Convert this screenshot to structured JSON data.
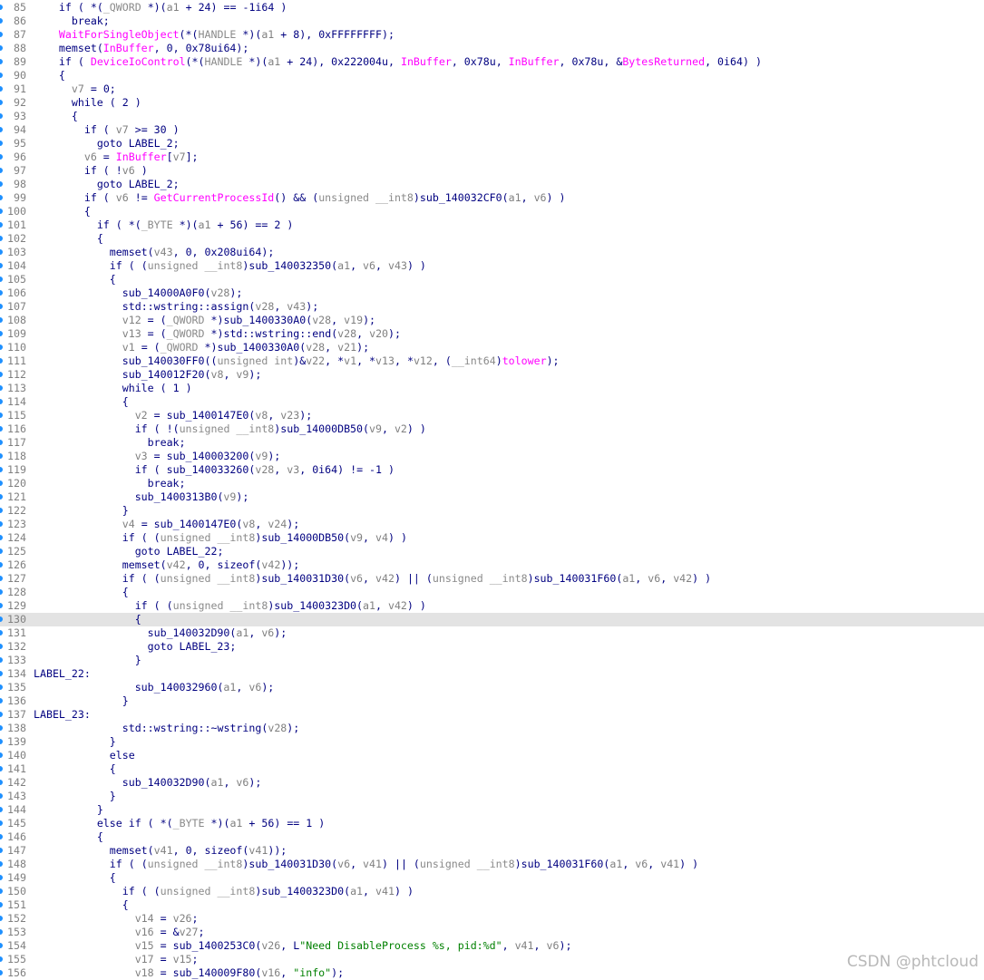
{
  "watermark": "CSDN @phtcloud",
  "highlighted_line": 130,
  "colors": {
    "text": "#000080",
    "variable": "#808080",
    "type": "#8a8a8a",
    "import_function": "#ff00ff",
    "line_number": "#808080",
    "string": "#008000",
    "marker_dot": "#1e90ff",
    "current_line_bg": "#e3e3e3"
  },
  "lines": [
    {
      "n": "85",
      "c": "    if ( *(_QWORD *)(a1 + 24) == -1i64 )"
    },
    {
      "n": "86",
      "c": "      break;"
    },
    {
      "n": "87",
      "c": "    WaitForSingleObject(*(HANDLE *)(a1 + 8), 0xFFFFFFFF);"
    },
    {
      "n": "88",
      "c": "    memset(InBuffer, 0, 0x78ui64);"
    },
    {
      "n": "89",
      "c": "    if ( DeviceIoControl(*(HANDLE *)(a1 + 24), 0x222004u, InBuffer, 0x78u, InBuffer, 0x78u, &BytesReturned, 0i64) )"
    },
    {
      "n": "90",
      "c": "    {"
    },
    {
      "n": "91",
      "c": "      v7 = 0;"
    },
    {
      "n": "92",
      "c": "      while ( 2 )"
    },
    {
      "n": "93",
      "c": "      {"
    },
    {
      "n": "94",
      "c": "        if ( v7 >= 30 )"
    },
    {
      "n": "95",
      "c": "          goto LABEL_2;"
    },
    {
      "n": "96",
      "c": "        v6 = InBuffer[v7];"
    },
    {
      "n": "97",
      "c": "        if ( !v6 )"
    },
    {
      "n": "98",
      "c": "          goto LABEL_2;"
    },
    {
      "n": "99",
      "c": "        if ( v6 != GetCurrentProcessId() && (unsigned __int8)sub_140032CF0(a1, v6) )"
    },
    {
      "n": "100",
      "c": "        {"
    },
    {
      "n": "101",
      "c": "          if ( *(_BYTE *)(a1 + 56) == 2 )"
    },
    {
      "n": "102",
      "c": "          {"
    },
    {
      "n": "103",
      "c": "            memset(v43, 0, 0x208ui64);"
    },
    {
      "n": "104",
      "c": "            if ( (unsigned __int8)sub_140032350(a1, v6, v43) )"
    },
    {
      "n": "105",
      "c": "            {"
    },
    {
      "n": "106",
      "c": "              sub_14000A0F0(v28);"
    },
    {
      "n": "107",
      "c": "              std::wstring::assign(v28, v43);"
    },
    {
      "n": "108",
      "c": "              v12 = (_QWORD *)sub_1400330A0(v28, v19);"
    },
    {
      "n": "109",
      "c": "              v13 = (_QWORD *)std::wstring::end(v28, v20);"
    },
    {
      "n": "110",
      "c": "              v1 = (_QWORD *)sub_1400330A0(v28, v21);"
    },
    {
      "n": "111",
      "c": "              sub_140030FF0((unsigned int)&v22, *v1, *v13, *v12, (__int64)tolower);"
    },
    {
      "n": "112",
      "c": "              sub_140012F20(v8, v9);"
    },
    {
      "n": "113",
      "c": "              while ( 1 )"
    },
    {
      "n": "114",
      "c": "              {"
    },
    {
      "n": "115",
      "c": "                v2 = sub_1400147E0(v8, v23);"
    },
    {
      "n": "116",
      "c": "                if ( !(unsigned __int8)sub_14000DB50(v9, v2) )"
    },
    {
      "n": "117",
      "c": "                  break;"
    },
    {
      "n": "118",
      "c": "                v3 = sub_140003200(v9);"
    },
    {
      "n": "119",
      "c": "                if ( sub_140033260(v28, v3, 0i64) != -1 )"
    },
    {
      "n": "120",
      "c": "                  break;"
    },
    {
      "n": "121",
      "c": "                sub_1400313B0(v9);"
    },
    {
      "n": "122",
      "c": "              }"
    },
    {
      "n": "123",
      "c": "              v4 = sub_1400147E0(v8, v24);"
    },
    {
      "n": "124",
      "c": "              if ( (unsigned __int8)sub_14000DB50(v9, v4) )"
    },
    {
      "n": "125",
      "c": "                goto LABEL_22;"
    },
    {
      "n": "126",
      "c": "              memset(v42, 0, sizeof(v42));"
    },
    {
      "n": "127",
      "c": "              if ( (unsigned __int8)sub_140031D30(v6, v42) || (unsigned __int8)sub_140031F60(a1, v6, v42) )"
    },
    {
      "n": "128",
      "c": "              {"
    },
    {
      "n": "129",
      "c": "                if ( (unsigned __int8)sub_1400323D0(a1, v42) )"
    },
    {
      "n": "130",
      "c": "                {"
    },
    {
      "n": "131",
      "c": "                  sub_140032D90(a1, v6);"
    },
    {
      "n": "132",
      "c": "                  goto LABEL_23;"
    },
    {
      "n": "133",
      "c": "                }"
    },
    {
      "n": "134",
      "c": "LABEL_22:"
    },
    {
      "n": "135",
      "c": "                sub_140032960(a1, v6);"
    },
    {
      "n": "136",
      "c": "              }"
    },
    {
      "n": "137",
      "c": "LABEL_23:"
    },
    {
      "n": "138",
      "c": "              std::wstring::~wstring(v28);"
    },
    {
      "n": "139",
      "c": "            }"
    },
    {
      "n": "140",
      "c": "            else"
    },
    {
      "n": "141",
      "c": "            {"
    },
    {
      "n": "142",
      "c": "              sub_140032D90(a1, v6);"
    },
    {
      "n": "143",
      "c": "            }"
    },
    {
      "n": "144",
      "c": "          }"
    },
    {
      "n": "145",
      "c": "          else if ( *(_BYTE *)(a1 + 56) == 1 )"
    },
    {
      "n": "146",
      "c": "          {"
    },
    {
      "n": "147",
      "c": "            memset(v41, 0, sizeof(v41));"
    },
    {
      "n": "148",
      "c": "            if ( (unsigned __int8)sub_140031D30(v6, v41) || (unsigned __int8)sub_140031F60(a1, v6, v41) )"
    },
    {
      "n": "149",
      "c": "            {"
    },
    {
      "n": "150",
      "c": "              if ( (unsigned __int8)sub_1400323D0(a1, v41) )"
    },
    {
      "n": "151",
      "c": "              {"
    },
    {
      "n": "152",
      "c": "                v14 = v26;"
    },
    {
      "n": "153",
      "c": "                v16 = &v27;"
    },
    {
      "n": "154",
      "c": "                v15 = sub_1400253C0(v26, L\"Need DisableProcess %s, pid:%d\", v41, v6);"
    },
    {
      "n": "155",
      "c": "                v17 = v15;"
    },
    {
      "n": "156",
      "c": "                v18 = sub_140009F80(v16, \"info\");"
    }
  ]
}
